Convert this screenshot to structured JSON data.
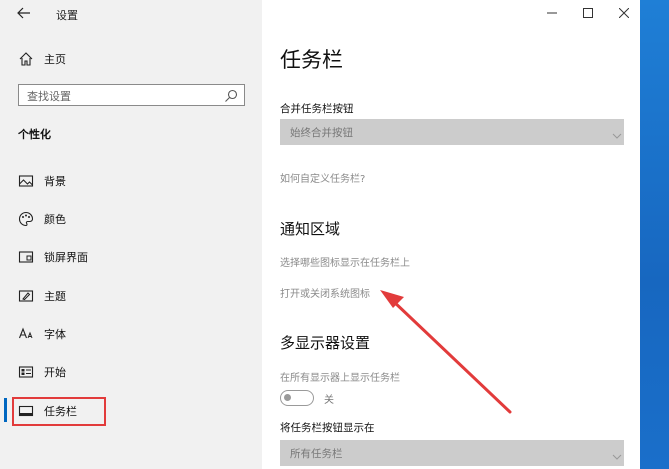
{
  "window": {
    "title": "设置"
  },
  "sidebar": {
    "home_label": "主页",
    "search_placeholder": "查找设置",
    "section_title": "个性化",
    "items": [
      {
        "label": "背景",
        "icon": "picture-icon"
      },
      {
        "label": "颜色",
        "icon": "palette-icon"
      },
      {
        "label": "锁屏界面",
        "icon": "lock-screen-icon"
      },
      {
        "label": "主题",
        "icon": "theme-brush-icon"
      },
      {
        "label": "字体",
        "icon": "font-icon"
      },
      {
        "label": "开始",
        "icon": "start-menu-icon"
      },
      {
        "label": "任务栏",
        "icon": "taskbar-icon",
        "selected": true
      }
    ]
  },
  "main": {
    "page_title": "任务栏",
    "combine_label": "合并任务栏按钮",
    "combine_value": "始终合并按钮",
    "customize_link": "如何自定义任务栏?",
    "notify_heading": "通知区域",
    "notify_link1": "选择哪些图标显示在任务栏上",
    "notify_link2": "打开或关闭系统图标",
    "multi_heading": "多显示器设置",
    "multi_show_label": "在所有显示器上显示任务栏",
    "multi_toggle_state": "关",
    "multi_buttons_label": "将任务栏按钮显示在",
    "multi_buttons_value": "所有任务栏"
  },
  "colors": {
    "accent": "#0067c0",
    "highlight_box": "#e23b3b",
    "annotation_arrow": "#e23b3b",
    "sidebar_bg": "#f1f1f1",
    "desktop_blue": "#1a73c9"
  }
}
